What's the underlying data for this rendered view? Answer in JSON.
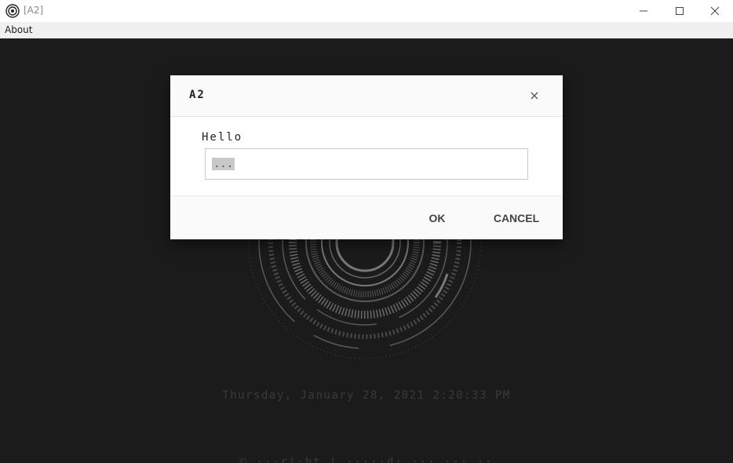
{
  "window": {
    "title": "[A2]",
    "controls": [
      "minimize-icon",
      "maximize-icon",
      "close-icon"
    ]
  },
  "menu": {
    "about": "About"
  },
  "main": {
    "datetime": "Thursday, January 28, 2021 2:20:33 PM",
    "footer": "© ···ri·ht | ·····d· ··· ··· ··"
  },
  "dialog": {
    "title": "A2",
    "close_glyph": "×",
    "prompt": "Hello",
    "input_value": "...",
    "ok_label": "OK",
    "cancel_label": "CANCEL"
  },
  "colors": {
    "background": "#1b1b1b",
    "dialog_bg": "#ffffff",
    "selection": "#c8c8c8",
    "dim_text": "#3a3a3a"
  }
}
